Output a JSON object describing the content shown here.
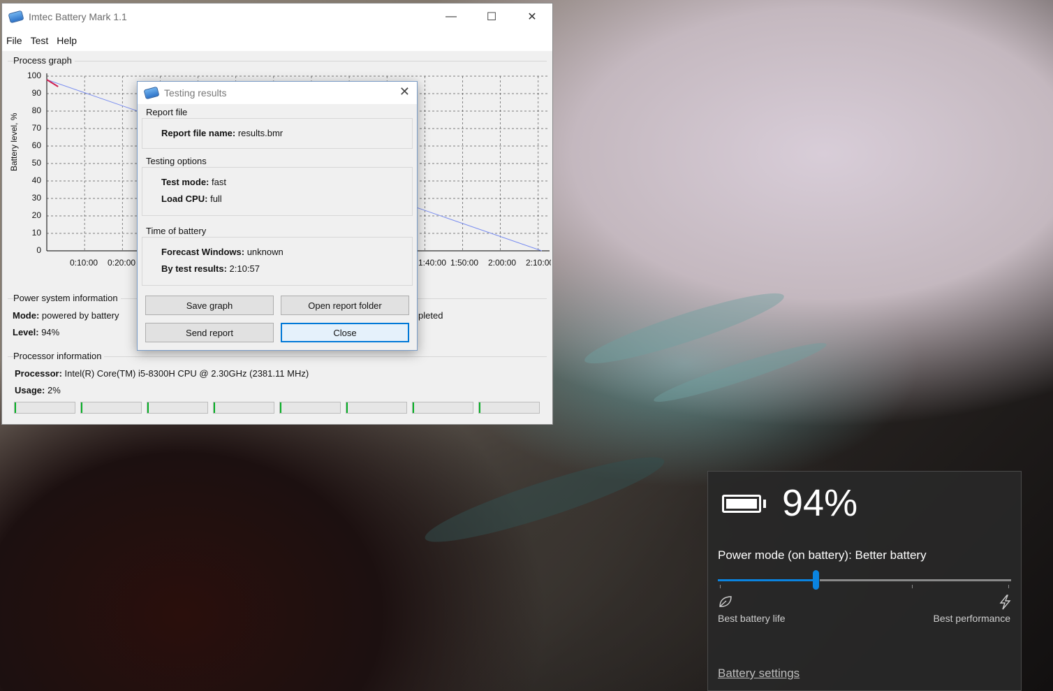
{
  "app": {
    "title": "Imtec Battery Mark 1.1",
    "menu": [
      "File",
      "Test",
      "Help"
    ],
    "process_graph_label": "Process graph",
    "y_axis_label": "Battery level, %",
    "y_ticks": [
      "100",
      "90",
      "80",
      "70",
      "60",
      "50",
      "40",
      "30",
      "20",
      "10",
      "0"
    ],
    "x_ticks_left": [
      "0:10:00",
      "0:20:00"
    ],
    "x_ticks_right": [
      "1:40:00",
      "1:50:00",
      "2:00:00",
      "2:10:00"
    ],
    "power_group_label": "Power system information",
    "mode_label": "Mode:",
    "mode_value": "powered by battery",
    "level_label": "Level:",
    "level_value": "94%",
    "partial_status": "pleted",
    "processor_group_label": "Processor information",
    "processor_label": "Processor:",
    "processor_value": "Intel(R) Core(TM) i5-8300H CPU @ 2.30GHz  (2381.11 MHz)",
    "usage_label": "Usage:",
    "usage_value": "2%",
    "cpu_core_usage": [
      0.02,
      0.0,
      0.01,
      0.0,
      0.02,
      0.01,
      0.0,
      0.0
    ]
  },
  "chart_data": {
    "type": "line",
    "ylabel": "Battery level, %",
    "ylim": [
      0,
      100
    ],
    "x_ticks": [
      "0:10:00",
      "0:20:00",
      "1:40:00",
      "1:50:00",
      "2:00:00",
      "2:10:00"
    ],
    "series": [
      {
        "x": [
          "0:00:00",
          "0:03:00"
        ],
        "y": [
          98,
          94
        ]
      },
      {
        "x": [
          "0:00:00",
          "2:10:57"
        ],
        "y": [
          98,
          0
        ]
      }
    ]
  },
  "dialog": {
    "title": "Testing results",
    "report_group": "Report file",
    "report_name_label": "Report file name:",
    "report_name_value": "results.bmr",
    "options_group": "Testing options",
    "test_mode_label": "Test mode:",
    "test_mode_value": "fast",
    "load_cpu_label": "Load CPU:",
    "load_cpu_value": "full",
    "time_group": "Time of battery",
    "forecast_label": "Forecast Windows:",
    "forecast_value": "unknown",
    "by_test_label": "By test results:",
    "by_test_value": "2:10:57",
    "buttons": {
      "save_graph": "Save graph",
      "open_report_folder": "Open report folder",
      "send_report": "Send report",
      "close": "Close"
    }
  },
  "flyout": {
    "percent": "94%",
    "power_mode": "Power mode (on battery): Better battery",
    "slider_position": 0.33,
    "left_label": "Best battery life",
    "right_label": "Best performance",
    "settings_link": "Battery settings"
  },
  "colors": {
    "accent": "#0a84e0",
    "graph_forecast_line": "#7a8ef0",
    "graph_measured_line": "#d02050"
  }
}
